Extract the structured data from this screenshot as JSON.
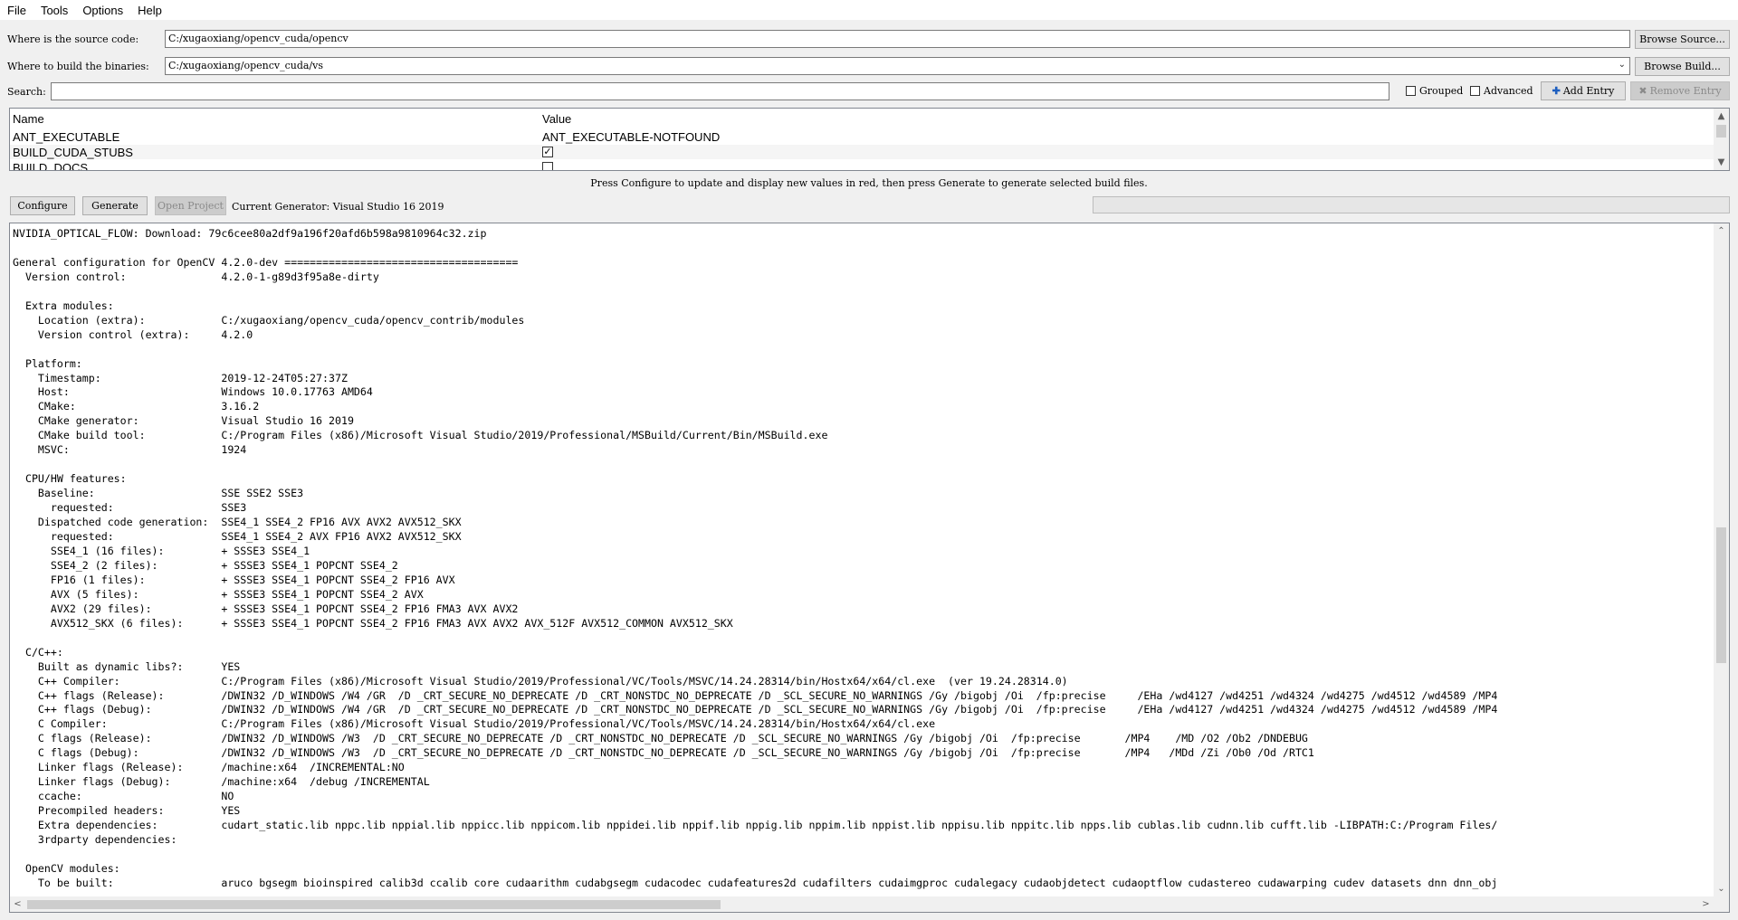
{
  "menu": [
    "File",
    "Tools",
    "Options",
    "Help"
  ],
  "source": {
    "label": "Where is the source code:",
    "value": "C:/xugaoxiang/opencv_cuda/opencv",
    "browse": "Browse Source..."
  },
  "build": {
    "label": "Where to build the binaries:",
    "value": "C:/xugaoxiang/opencv_cuda/vs",
    "browse": "Browse Build..."
  },
  "search": {
    "label": "Search:",
    "value": "",
    "grouped": "Grouped",
    "advanced": "Advanced",
    "add_entry": "Add Entry",
    "remove_entry": "Remove Entry"
  },
  "table": {
    "col_name": "Name",
    "col_value": "Value",
    "rows": [
      {
        "name": "ANT_EXECUTABLE",
        "value": "ANT_EXECUTABLE-NOTFOUND"
      },
      {
        "name": "BUILD_CUDA_STUBS",
        "value": "",
        "checked": true
      },
      {
        "name": "BUILD_DOCS",
        "value": "",
        "checked": false
      }
    ]
  },
  "hint": "Press Configure to update and display new values in red, then press Generate to generate selected build files.",
  "actions": {
    "configure": "Configure",
    "generate": "Generate",
    "open_project": "Open Project",
    "generator": "Current Generator: Visual Studio 16 2019"
  },
  "output": {
    "lines": [
      "NVIDIA_OPTICAL_FLOW: Download: 79c6cee80a2df9a196f20afd6b598a9810964c32.zip",
      "",
      "General configuration for OpenCV 4.2.0-dev =====================================",
      "  Version control:               4.2.0-1-g89d3f95a8e-dirty",
      "",
      "  Extra modules:",
      "    Location (extra):            C:/xugaoxiang/opencv_cuda/opencv_contrib/modules",
      "    Version control (extra):     4.2.0",
      "",
      "  Platform:",
      "    Timestamp:                   2019-12-24T05:27:37Z",
      "    Host:                        Windows 10.0.17763 AMD64",
      "    CMake:                       3.16.2",
      "    CMake generator:             Visual Studio 16 2019",
      "    CMake build tool:            C:/Program Files (x86)/Microsoft Visual Studio/2019/Professional/MSBuild/Current/Bin/MSBuild.exe",
      "    MSVC:                        1924",
      "",
      "  CPU/HW features:",
      "    Baseline:                    SSE SSE2 SSE3",
      "      requested:                 SSE3",
      "    Dispatched code generation:  SSE4_1 SSE4_2 FP16 AVX AVX2 AVX512_SKX",
      "      requested:                 SSE4_1 SSE4_2 AVX FP16 AVX2 AVX512_SKX",
      "      SSE4_1 (16 files):         + SSSE3 SSE4_1",
      "      SSE4_2 (2 files):          + SSSE3 SSE4_1 POPCNT SSE4_2",
      "      FP16 (1 files):            + SSSE3 SSE4_1 POPCNT SSE4_2 FP16 AVX",
      "      AVX (5 files):             + SSSE3 SSE4_1 POPCNT SSE4_2 AVX",
      "      AVX2 (29 files):           + SSSE3 SSE4_1 POPCNT SSE4_2 FP16 FMA3 AVX AVX2",
      "      AVX512_SKX (6 files):      + SSSE3 SSE4_1 POPCNT SSE4_2 FP16 FMA3 AVX AVX2 AVX_512F AVX512_COMMON AVX512_SKX",
      "",
      "  C/C++:",
      "    Built as dynamic libs?:      YES",
      "    C++ Compiler:                C:/Program Files (x86)/Microsoft Visual Studio/2019/Professional/VC/Tools/MSVC/14.24.28314/bin/Hostx64/x64/cl.exe  (ver 19.24.28314.0)",
      "    C++ flags (Release):         /DWIN32 /D_WINDOWS /W4 /GR  /D _CRT_SECURE_NO_DEPRECATE /D _CRT_NONSTDC_NO_DEPRECATE /D _SCL_SECURE_NO_WARNINGS /Gy /bigobj /Oi  /fp:precise     /EHa /wd4127 /wd4251 /wd4324 /wd4275 /wd4512 /wd4589 /MP4",
      "    C++ flags (Debug):           /DWIN32 /D_WINDOWS /W4 /GR  /D _CRT_SECURE_NO_DEPRECATE /D _CRT_NONSTDC_NO_DEPRECATE /D _SCL_SECURE_NO_WARNINGS /Gy /bigobj /Oi  /fp:precise     /EHa /wd4127 /wd4251 /wd4324 /wd4275 /wd4512 /wd4589 /MP4",
      "    C Compiler:                  C:/Program Files (x86)/Microsoft Visual Studio/2019/Professional/VC/Tools/MSVC/14.24.28314/bin/Hostx64/x64/cl.exe",
      "    C flags (Release):           /DWIN32 /D_WINDOWS /W3  /D _CRT_SECURE_NO_DEPRECATE /D _CRT_NONSTDC_NO_DEPRECATE /D _SCL_SECURE_NO_WARNINGS /Gy /bigobj /Oi  /fp:precise       /MP4    /MD /O2 /Ob2 /DNDEBUG",
      "    C flags (Debug):             /DWIN32 /D_WINDOWS /W3  /D _CRT_SECURE_NO_DEPRECATE /D _CRT_NONSTDC_NO_DEPRECATE /D _SCL_SECURE_NO_WARNINGS /Gy /bigobj /Oi  /fp:precise       /MP4   /MDd /Zi /Ob0 /Od /RTC1",
      "    Linker flags (Release):      /machine:x64  /INCREMENTAL:NO",
      "    Linker flags (Debug):        /machine:x64  /debug /INCREMENTAL",
      "    ccache:                      NO",
      "    Precompiled headers:         YES",
      "    Extra dependencies:          cudart_static.lib nppc.lib nppial.lib nppicc.lib nppicom.lib nppidei.lib nppif.lib nppig.lib nppim.lib nppist.lib nppisu.lib nppitc.lib npps.lib cublas.lib cudnn.lib cufft.lib -LIBPATH:C:/Program Files/",
      "    3rdparty dependencies:",
      "",
      "  OpenCV modules:",
      "    To be built:                 aruco bgsegm bioinspired calib3d ccalib core cudaarithm cudabgsegm cudacodec cudafeatures2d cudafilters cudaimgproc cudalegacy cudaobjdetect cudaoptflow cudastereo cudawarping cudev datasets dnn dnn_obj"
    ]
  }
}
